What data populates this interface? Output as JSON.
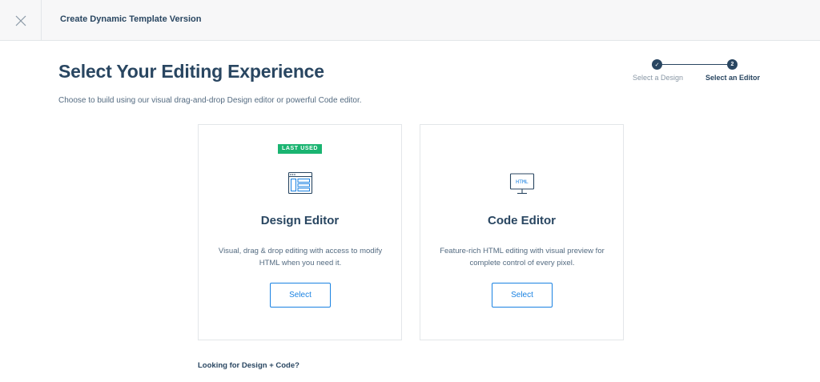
{
  "header": {
    "title": "Create Dynamic Template Version",
    "close_icon": "close-icon"
  },
  "main": {
    "title": "Select Your Editing Experience",
    "subtitle": "Choose to build using our visual drag-and-drop Design editor or powerful Code editor.",
    "footer_link": "Looking for Design + Code?"
  },
  "stepper": {
    "steps": [
      {
        "number": "✓",
        "label": "Select a Design",
        "status": "complete"
      },
      {
        "number": "2",
        "label": "Select an Editor",
        "status": "active"
      }
    ]
  },
  "cards": [
    {
      "badge": "LAST USED",
      "icon": "design-editor-icon",
      "title": "Design Editor",
      "description": "Visual, drag & drop editing with access to modify HTML when you need it.",
      "button_label": "Select"
    },
    {
      "icon": "html-monitor-icon",
      "icon_text": "HTML",
      "title": "Code Editor",
      "description": "Feature-rich HTML editing with visual preview for complete control of every pixel.",
      "button_label": "Select"
    }
  ],
  "colors": {
    "primary_text": "#294661",
    "accent_blue": "#1a82e2",
    "badge_green": "#1ab471",
    "topbar_bg": "#f7f7f8"
  }
}
